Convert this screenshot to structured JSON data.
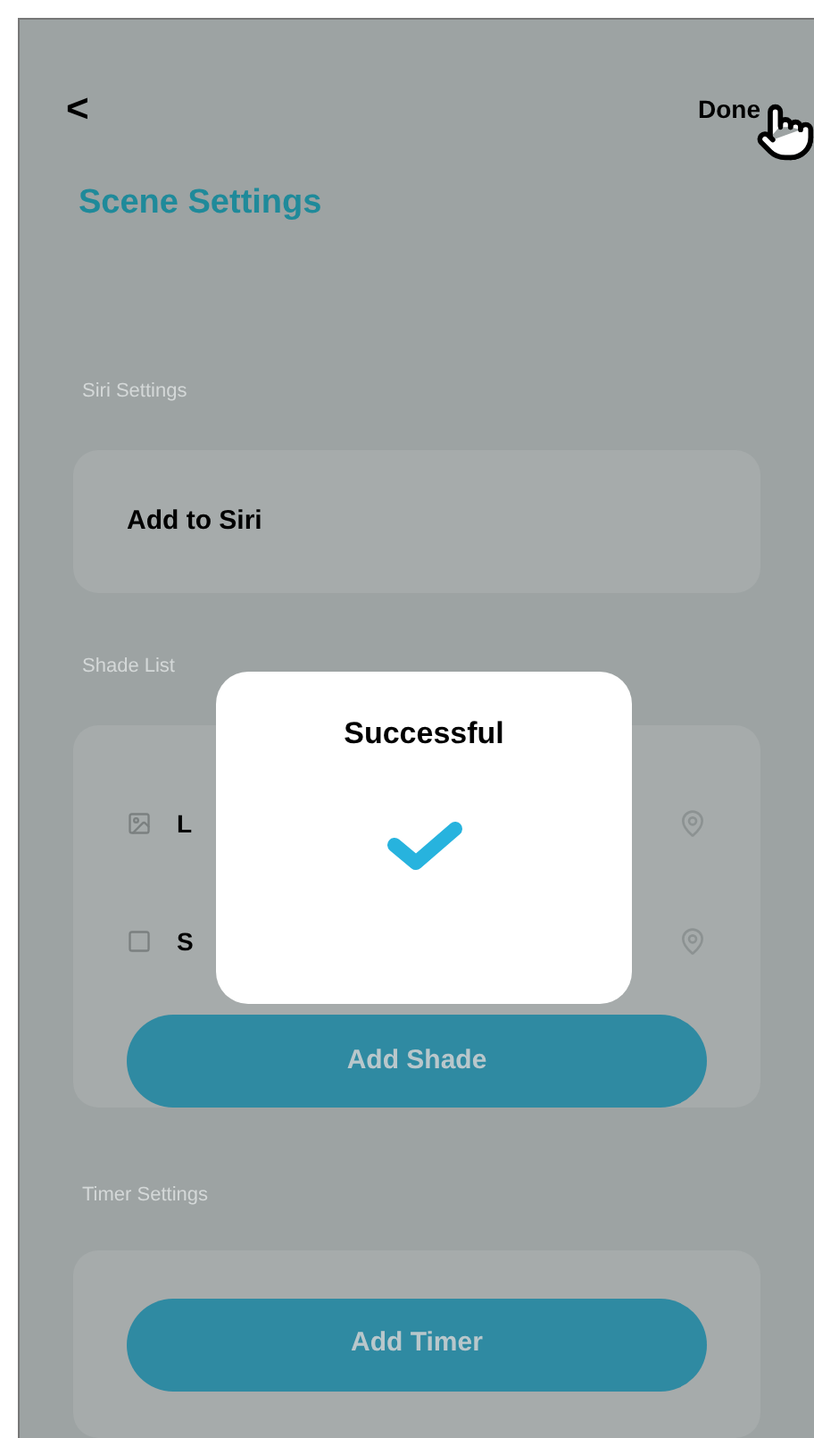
{
  "header": {
    "back": "<",
    "done": "Done",
    "title": "Scene Settings"
  },
  "siri": {
    "label": "Siri Settings",
    "item": "Add to Siri"
  },
  "shades": {
    "label": "Shade List",
    "items": [
      {
        "name": "L"
      },
      {
        "name": "S"
      }
    ],
    "button": "Add Shade"
  },
  "timer": {
    "label": "Timer Settings",
    "button": "Add Timer"
  },
  "dialog": {
    "title": "Successful"
  }
}
